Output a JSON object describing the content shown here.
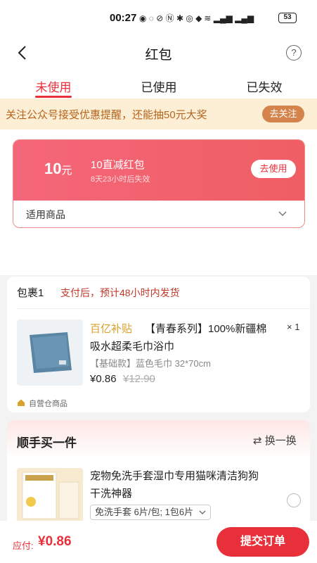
{
  "status_bar": {
    "time": "00:27",
    "battery": "53"
  },
  "header": {
    "title": "红包"
  },
  "tabs": [
    {
      "label": "未使用",
      "active": true
    },
    {
      "label": "已使用",
      "active": false
    },
    {
      "label": "已失效",
      "active": false
    }
  ],
  "notice": {
    "text": "关注公众号接受优惠提醒，还能抽50元大奖",
    "button": "去关注"
  },
  "coupon": {
    "amount": "10",
    "unit": "元",
    "title": "10直减红包",
    "expiry": "8天23小时后失效",
    "use_button": "去使用",
    "applies_label": "适用商品"
  },
  "package": {
    "label": "包裹1",
    "shipping": "支付后，预计48小时内发货",
    "product": {
      "brand_tag": "百亿补贴",
      "name_line1": "【青春系列】100%新疆棉",
      "name_line2": "吸水超柔毛巾浴巾",
      "quantity": "× 1",
      "spec": "【基础款】蓝色毛巾 32*70cm",
      "price": "¥0.86",
      "original_price": "¥12.90"
    },
    "warehouse": "自营仓商品"
  },
  "buy_more": {
    "title": "顺手买一件",
    "swap": "换一换",
    "product": {
      "name_line1": "宠物免洗手套湿巾专用猫咪清洁狗狗",
      "name_line2": "干洗神器",
      "option": "免洗手套 6片/包; 1包6片"
    }
  },
  "footer": {
    "pay_label": "应付:",
    "pay_amount": "¥0.86",
    "submit": "提交订单"
  },
  "colors": {
    "accent": "#e8303a",
    "notice_bg": "#fdeed6",
    "notice_text": "#b5651d",
    "coupon_gradient": "#f4677a"
  }
}
